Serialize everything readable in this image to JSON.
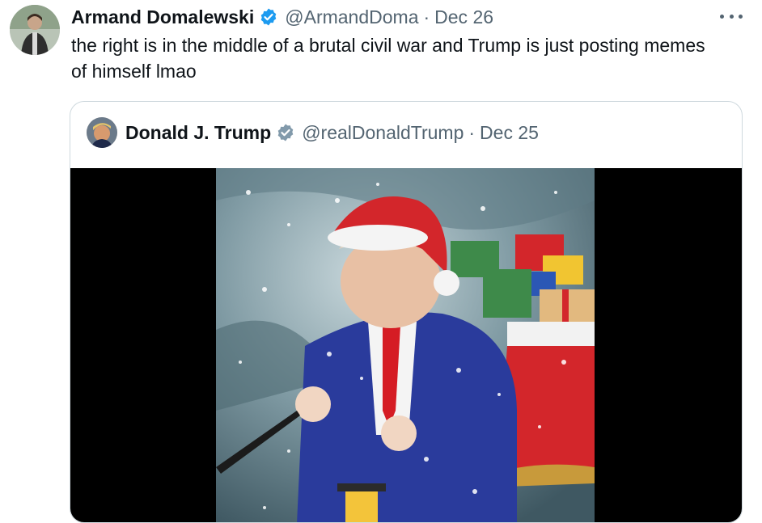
{
  "author": {
    "name": "Armand Domalewski",
    "handle": "@ArmandDoma",
    "separator": "·",
    "date": "Dec 26",
    "text": "the right is in the middle of a brutal civil war and Trump is just posting memes of himself lmao"
  },
  "quoted": {
    "name": "Donald J. Trump",
    "handle": "@realDonaldTrump",
    "separator": "·",
    "date": "Dec 25"
  },
  "icons": {
    "author_badge": "verified-badge-icon",
    "quoted_badge": "gray-verified-badge-icon",
    "menu": "more-options-icon"
  },
  "colors": {
    "verified_blue": "#1d9bf0",
    "gov_gray": "#829aab",
    "secondary_text": "#536471"
  }
}
